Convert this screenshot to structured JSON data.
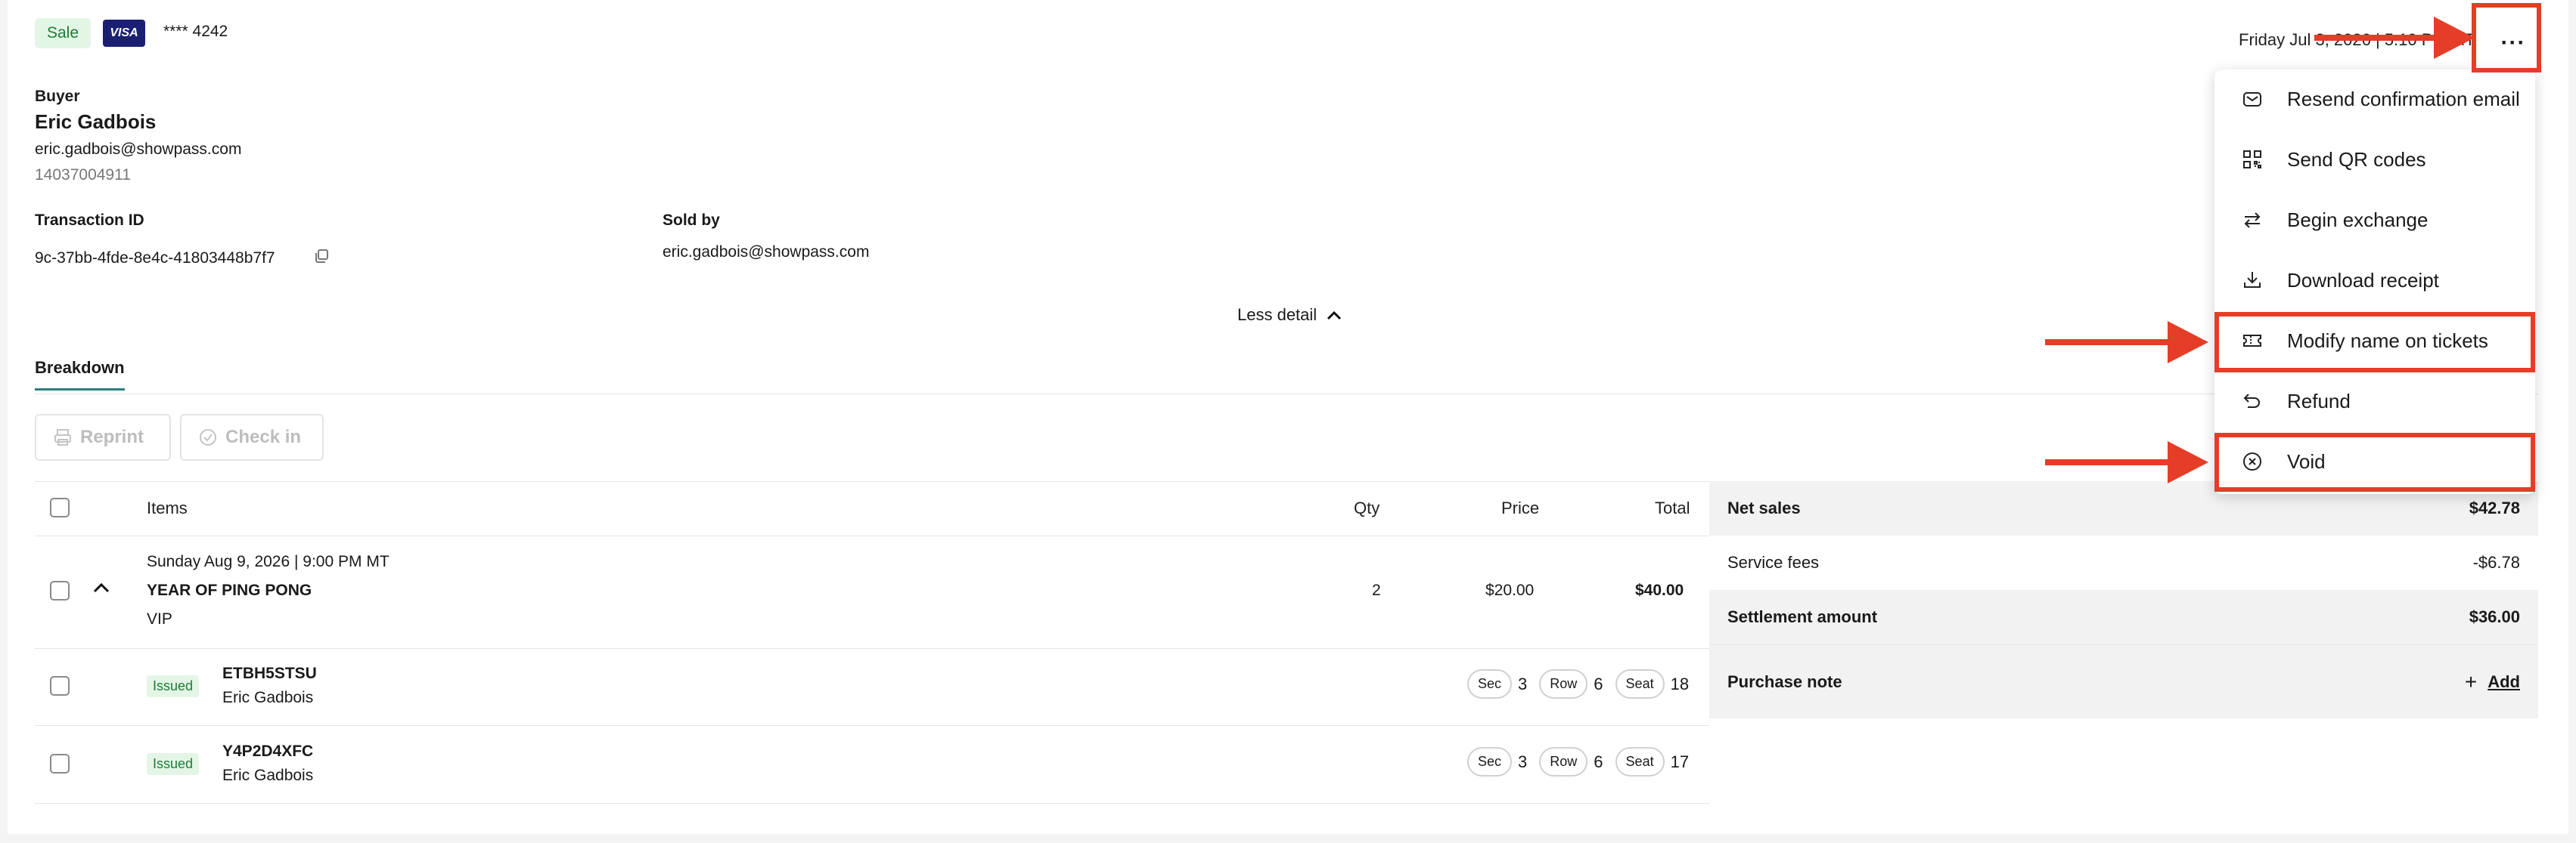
{
  "header": {
    "status": "Sale",
    "card_brand": "VISA",
    "card_last4": "**** 4242",
    "datetime": "Friday Jul 3, 2026 | 5:10 PM MT",
    "more_label": "···"
  },
  "buyer": {
    "label": "Buyer",
    "name": "Eric Gadbois",
    "email": "eric.gadbois@showpass.com",
    "phone": "14037004911"
  },
  "transaction": {
    "id_label": "Transaction ID",
    "id_value": "9c-37bb-4fde-8e4c-41803448b7f7",
    "sold_by_label": "Sold by",
    "sold_by_value": "eric.gadbois@showpass.com"
  },
  "less_detail": "Less detail",
  "tabs": [
    {
      "label": "Breakdown",
      "active": true
    }
  ],
  "actions": {
    "reprint": "Reprint",
    "check_in": "Check in"
  },
  "table": {
    "headers": {
      "items": "Items",
      "qty": "Qty",
      "price": "Price",
      "total": "Total"
    },
    "event": {
      "date": "Sunday Aug 9, 2026 | 9:00 PM MT",
      "name": "YEAR OF PING PONG",
      "tier": "VIP",
      "qty": "2",
      "price": "$20.00",
      "total": "$40.00"
    },
    "tickets": [
      {
        "status": "Issued",
        "code": "ETBH5STSU",
        "holder": "Eric Gadbois",
        "sec_label": "Sec",
        "sec": "3",
        "row_label": "Row",
        "row": "6",
        "seat_label": "Seat",
        "seat": "18"
      },
      {
        "status": "Issued",
        "code": "Y4P2D4XFC",
        "holder": "Eric Gadbois",
        "sec_label": "Sec",
        "sec": "3",
        "row_label": "Row",
        "row": "6",
        "seat_label": "Seat",
        "seat": "17"
      }
    ]
  },
  "summary": {
    "net_sales_label": "Net sales",
    "net_sales": "$42.78",
    "service_fees_label": "Service fees",
    "service_fees": "-$6.78",
    "settlement_label": "Settlement amount",
    "settlement": "$36.00",
    "purchase_note_label": "Purchase note",
    "add_label": "Add"
  },
  "menu": {
    "items": [
      {
        "label": "Resend confirmation email",
        "icon": "mail-icon"
      },
      {
        "label": "Send QR codes",
        "icon": "qr-code-icon"
      },
      {
        "label": "Begin exchange",
        "icon": "exchange-arrows-icon"
      },
      {
        "label": "Download receipt",
        "icon": "download-icon"
      },
      {
        "label": "Modify name on tickets",
        "icon": "ticket-icon",
        "highlighted": true
      },
      {
        "label": "Refund",
        "icon": "undo-arrow-icon"
      },
      {
        "label": "Void",
        "icon": "circle-x-icon",
        "highlighted": true
      }
    ]
  },
  "annotation_color": "#e53d27"
}
